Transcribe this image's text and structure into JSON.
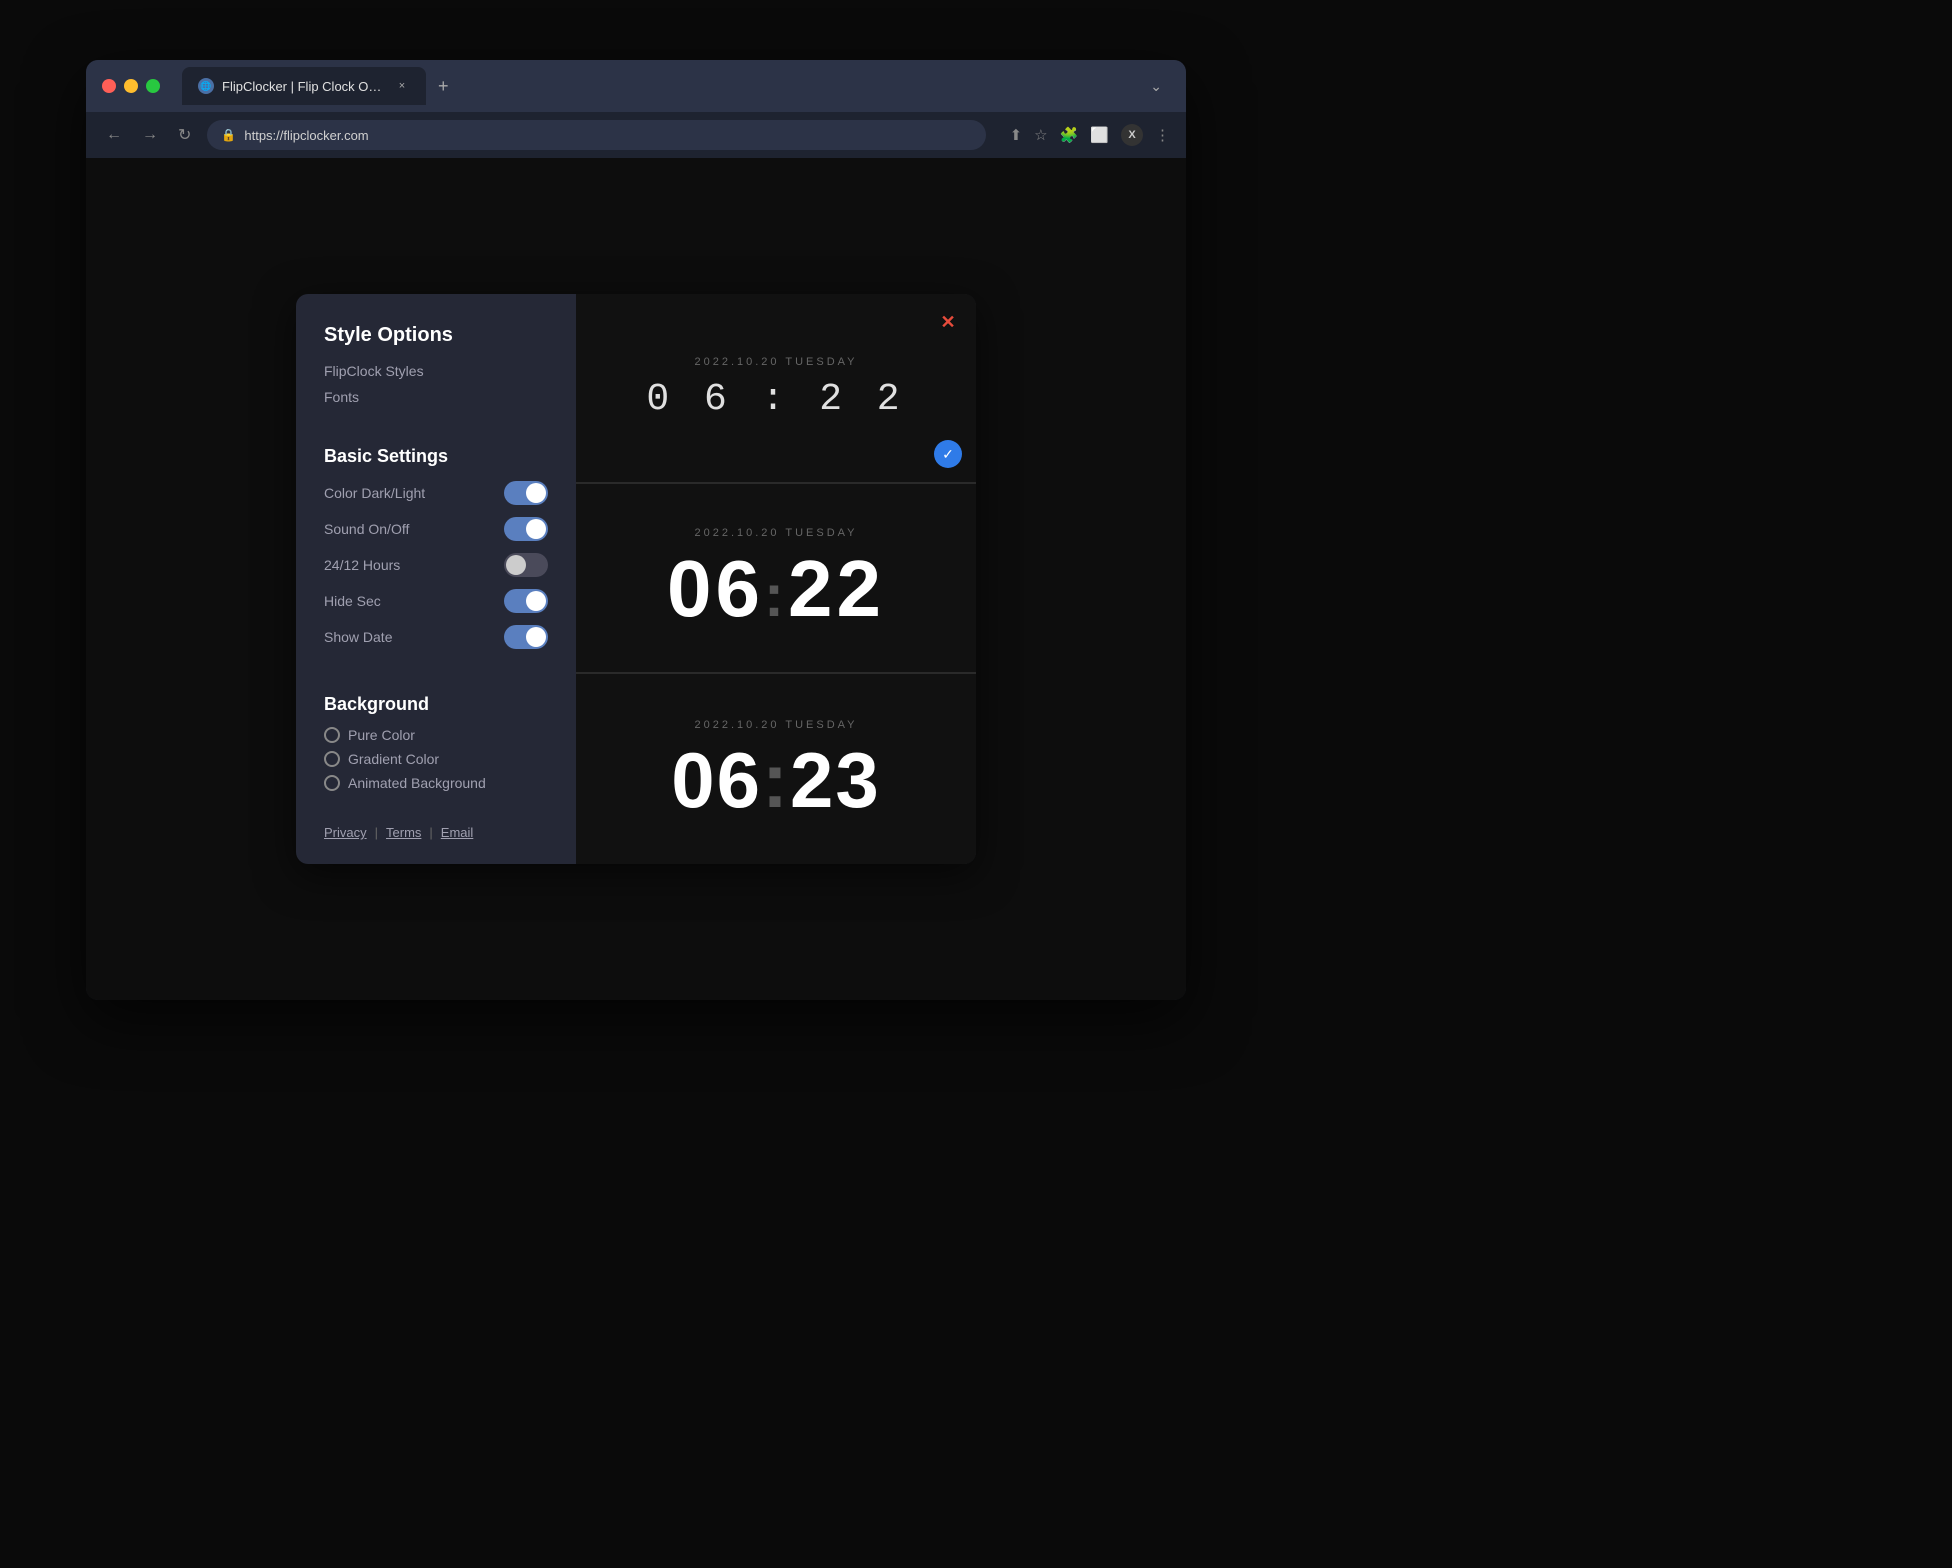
{
  "browser": {
    "tab_title": "FlipClocker | Flip Clock Online",
    "tab_close": "×",
    "tab_new": "+",
    "tab_menu": "⌄",
    "nav_back": "←",
    "nav_forward": "→",
    "nav_refresh": "↻",
    "url": "https://flipclocker.com",
    "url_actions": [
      "⬆",
      "★",
      "🧩",
      "⬜",
      "✕",
      "⋮"
    ]
  },
  "modal": {
    "close_btn": "✕",
    "style_options": {
      "section_title": "Style Options",
      "nav_links": [
        "FlipClock Styles",
        "Fonts"
      ]
    },
    "basic_settings": {
      "section_title": "Basic Settings",
      "settings": [
        {
          "label": "Color Dark/Light",
          "state": "on"
        },
        {
          "label": "Sound On/Off",
          "state": "on"
        },
        {
          "label": "24/12 Hours",
          "state": "off"
        },
        {
          "label": "Hide Sec",
          "state": "on"
        },
        {
          "label": "Show Date",
          "state": "on"
        }
      ]
    },
    "background": {
      "section_title": "Background",
      "options": [
        "Pure Color",
        "Gradient Color",
        "Animated Background"
      ]
    },
    "footer": {
      "links": [
        "Privacy",
        "Terms",
        "Email"
      ],
      "separators": [
        "|",
        "|"
      ]
    }
  },
  "clocks": [
    {
      "date": "2022.10.20 TUESDAY",
      "time": "0 6 : 2 2",
      "style": "small",
      "selected": true
    },
    {
      "date": "2022.10.20 TUESDAY",
      "time_h": "06",
      "colon": ":",
      "time_m": "22",
      "style": "large",
      "selected": false
    },
    {
      "date": "2022.10.20 TUESDAY",
      "time_h": "06",
      "colon": ":",
      "time_m": "23",
      "style": "large",
      "selected": false
    }
  ]
}
